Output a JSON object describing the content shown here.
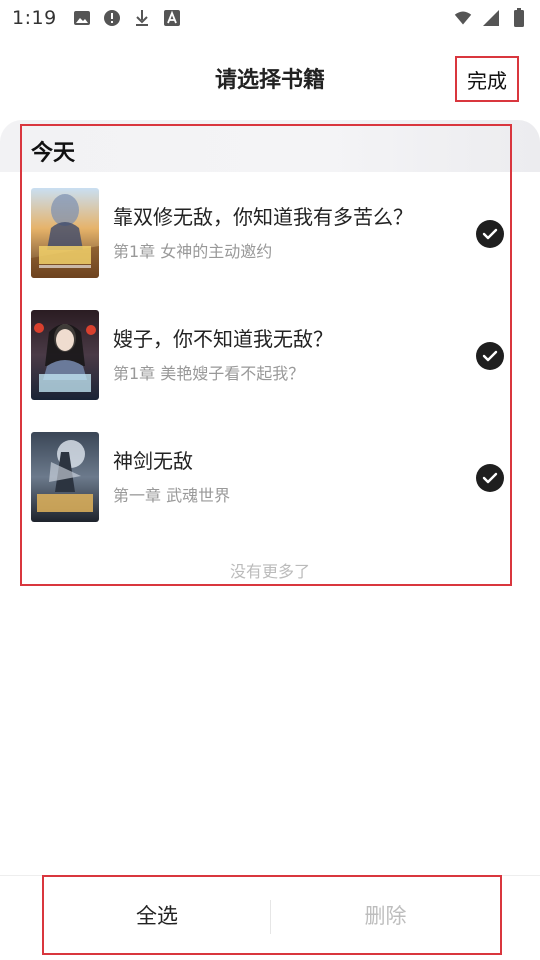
{
  "status_bar": {
    "time": "1:19",
    "left_icons": [
      "image-icon",
      "alert-circle-icon",
      "download-icon",
      "font-a-icon"
    ],
    "right_icons": [
      "wifi-icon",
      "signal-icon",
      "battery-icon"
    ]
  },
  "header": {
    "title": "请选择书籍",
    "done_label": "完成"
  },
  "section": {
    "title": "今天"
  },
  "books": [
    {
      "title": "靠双修无敌，你知道我有多苦么？",
      "chapter": "第1章 女神的主动邀约",
      "checked": true
    },
    {
      "title": "嫂子，你不知道我无敌？",
      "chapter": "第1章 美艳嫂子看不起我？",
      "checked": true
    },
    {
      "title": "神剑无敌",
      "chapter": "第一章 武魂世界",
      "checked": true
    }
  ],
  "no_more_text": "没有更多了",
  "bottom_bar": {
    "select_all_label": "全选",
    "delete_label": "删除"
  },
  "colors": {
    "highlight": "#d9363e",
    "check_bg": "#1f1f1f",
    "muted_text": "#999999",
    "disabled_text": "#bdbdbd"
  }
}
